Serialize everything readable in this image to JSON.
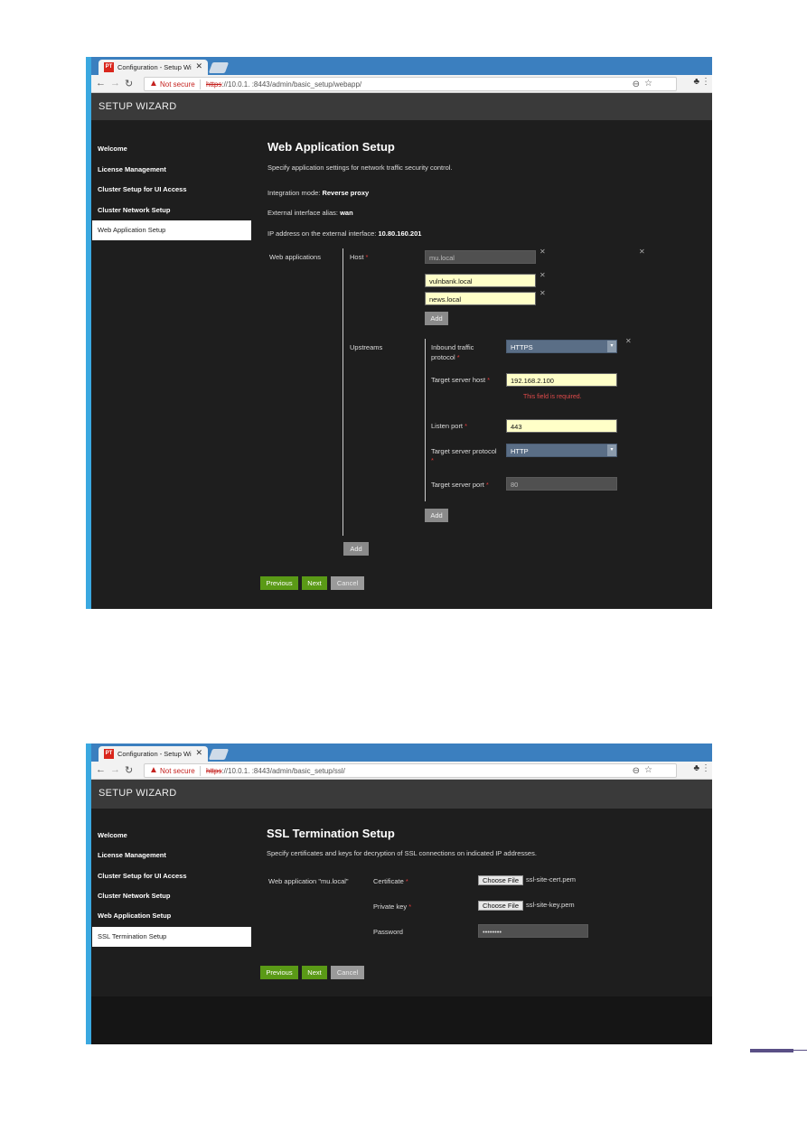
{
  "shot1": {
    "tab_title": "Configuration - Setup Wi",
    "favicon": "PT",
    "not_secure": "Not secure",
    "url_proto": "https",
    "url_rest": "://10.0.1.  :8443/admin/basic_setup/webapp/",
    "header_title": "SETUP WIZARD",
    "sidebar": [
      "Welcome",
      "License Management",
      "Cluster Setup for UI Access",
      "Cluster Network Setup",
      "Web Application Setup"
    ],
    "page_title": "Web Application Setup",
    "subtitle": "Specify application settings for network traffic security control.",
    "integration_mode_label": "Integration mode:",
    "integration_mode_value": "Reverse proxy",
    "external_alias_label": "External interface alias:",
    "external_alias_value": "wan",
    "ip_label": "IP address on the external interface:",
    "ip_value": "10.80.160.201",
    "web_apps_label": "Web applications",
    "host_label": "Host",
    "required_mark": "*",
    "hosts": [
      "mu.local",
      "vulnbank.local",
      "news.local"
    ],
    "add_label": "Add",
    "upstreams_label": "Upstreams",
    "inbound_label_1": "Inbound traffic",
    "inbound_label_2": "protocol",
    "inbound_value": "HTTPS",
    "target_host_label": "Target server host",
    "target_host_value": "192.168.2.100",
    "error_text": "This field is required.",
    "listen_port_label": "Listen port",
    "listen_port_value": "443",
    "target_protocol_label": "Target server protocol",
    "target_protocol_value": "HTTP",
    "target_port_label": "Target server port",
    "target_port_value": "80",
    "prev_label": "Previous",
    "next_label": "Next",
    "cancel_label": "Cancel"
  },
  "shot2": {
    "tab_title": "Configuration - Setup Wi",
    "favicon": "PT",
    "not_secure": "Not secure",
    "url_proto": "https",
    "url_rest": "://10.0.1.  :8443/admin/basic_setup/ssl/",
    "header_title": "SETUP WIZARD",
    "sidebar": [
      "Welcome",
      "License Management",
      "Cluster Setup for UI Access",
      "Cluster Network Setup",
      "Web Application Setup",
      "SSL Termination Setup"
    ],
    "page_title": "SSL Termination Setup",
    "subtitle": "Specify certificates and keys for decryption of SSL connections on indicated IP addresses.",
    "web_app_label": "Web application \"mu.local\"",
    "certificate_label": "Certificate",
    "private_key_label": "Private key",
    "password_label": "Password",
    "required_mark": "*",
    "choose_file_label": "Choose File",
    "cert_file": "ssl-site-cert.pem",
    "key_file": "ssl-site-key.pem",
    "password_value": "••••••••",
    "prev_label": "Previous",
    "next_label": "Next",
    "cancel_label": "Cancel"
  },
  "colors": {
    "accent_green": "#5a9a16",
    "required_red": "#e03a3a",
    "tabbar_blue": "#3b7fbf",
    "highlight_input": "#ffffc8"
  }
}
